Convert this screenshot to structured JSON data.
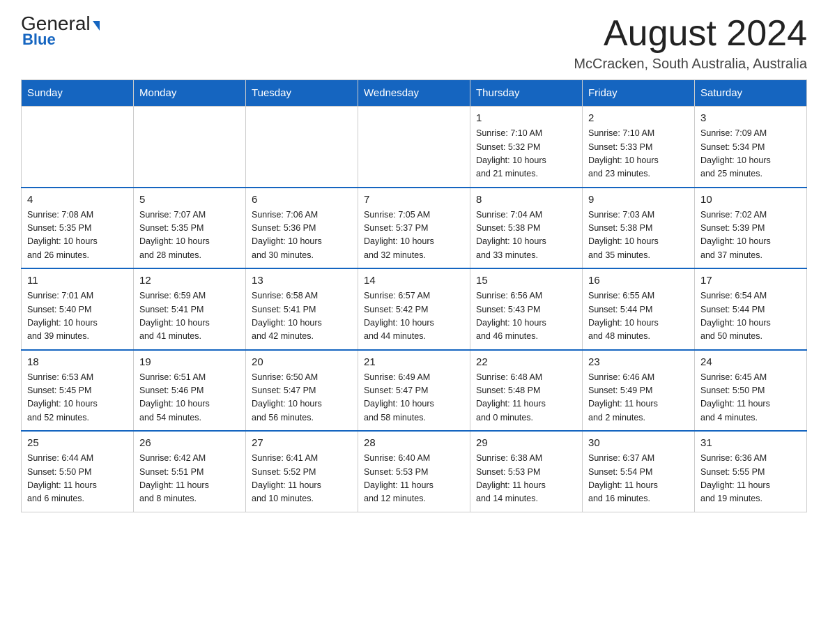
{
  "logo": {
    "part1": "General",
    "arrow": "▶",
    "part2": "Blue"
  },
  "title": "August 2024",
  "location": "McCracken, South Australia, Australia",
  "days_of_week": [
    "Sunday",
    "Monday",
    "Tuesday",
    "Wednesday",
    "Thursday",
    "Friday",
    "Saturday"
  ],
  "weeks": [
    [
      {
        "day": "",
        "info": ""
      },
      {
        "day": "",
        "info": ""
      },
      {
        "day": "",
        "info": ""
      },
      {
        "day": "",
        "info": ""
      },
      {
        "day": "1",
        "info": "Sunrise: 7:10 AM\nSunset: 5:32 PM\nDaylight: 10 hours\nand 21 minutes."
      },
      {
        "day": "2",
        "info": "Sunrise: 7:10 AM\nSunset: 5:33 PM\nDaylight: 10 hours\nand 23 minutes."
      },
      {
        "day": "3",
        "info": "Sunrise: 7:09 AM\nSunset: 5:34 PM\nDaylight: 10 hours\nand 25 minutes."
      }
    ],
    [
      {
        "day": "4",
        "info": "Sunrise: 7:08 AM\nSunset: 5:35 PM\nDaylight: 10 hours\nand 26 minutes."
      },
      {
        "day": "5",
        "info": "Sunrise: 7:07 AM\nSunset: 5:35 PM\nDaylight: 10 hours\nand 28 minutes."
      },
      {
        "day": "6",
        "info": "Sunrise: 7:06 AM\nSunset: 5:36 PM\nDaylight: 10 hours\nand 30 minutes."
      },
      {
        "day": "7",
        "info": "Sunrise: 7:05 AM\nSunset: 5:37 PM\nDaylight: 10 hours\nand 32 minutes."
      },
      {
        "day": "8",
        "info": "Sunrise: 7:04 AM\nSunset: 5:38 PM\nDaylight: 10 hours\nand 33 minutes."
      },
      {
        "day": "9",
        "info": "Sunrise: 7:03 AM\nSunset: 5:38 PM\nDaylight: 10 hours\nand 35 minutes."
      },
      {
        "day": "10",
        "info": "Sunrise: 7:02 AM\nSunset: 5:39 PM\nDaylight: 10 hours\nand 37 minutes."
      }
    ],
    [
      {
        "day": "11",
        "info": "Sunrise: 7:01 AM\nSunset: 5:40 PM\nDaylight: 10 hours\nand 39 minutes."
      },
      {
        "day": "12",
        "info": "Sunrise: 6:59 AM\nSunset: 5:41 PM\nDaylight: 10 hours\nand 41 minutes."
      },
      {
        "day": "13",
        "info": "Sunrise: 6:58 AM\nSunset: 5:41 PM\nDaylight: 10 hours\nand 42 minutes."
      },
      {
        "day": "14",
        "info": "Sunrise: 6:57 AM\nSunset: 5:42 PM\nDaylight: 10 hours\nand 44 minutes."
      },
      {
        "day": "15",
        "info": "Sunrise: 6:56 AM\nSunset: 5:43 PM\nDaylight: 10 hours\nand 46 minutes."
      },
      {
        "day": "16",
        "info": "Sunrise: 6:55 AM\nSunset: 5:44 PM\nDaylight: 10 hours\nand 48 minutes."
      },
      {
        "day": "17",
        "info": "Sunrise: 6:54 AM\nSunset: 5:44 PM\nDaylight: 10 hours\nand 50 minutes."
      }
    ],
    [
      {
        "day": "18",
        "info": "Sunrise: 6:53 AM\nSunset: 5:45 PM\nDaylight: 10 hours\nand 52 minutes."
      },
      {
        "day": "19",
        "info": "Sunrise: 6:51 AM\nSunset: 5:46 PM\nDaylight: 10 hours\nand 54 minutes."
      },
      {
        "day": "20",
        "info": "Sunrise: 6:50 AM\nSunset: 5:47 PM\nDaylight: 10 hours\nand 56 minutes."
      },
      {
        "day": "21",
        "info": "Sunrise: 6:49 AM\nSunset: 5:47 PM\nDaylight: 10 hours\nand 58 minutes."
      },
      {
        "day": "22",
        "info": "Sunrise: 6:48 AM\nSunset: 5:48 PM\nDaylight: 11 hours\nand 0 minutes."
      },
      {
        "day": "23",
        "info": "Sunrise: 6:46 AM\nSunset: 5:49 PM\nDaylight: 11 hours\nand 2 minutes."
      },
      {
        "day": "24",
        "info": "Sunrise: 6:45 AM\nSunset: 5:50 PM\nDaylight: 11 hours\nand 4 minutes."
      }
    ],
    [
      {
        "day": "25",
        "info": "Sunrise: 6:44 AM\nSunset: 5:50 PM\nDaylight: 11 hours\nand 6 minutes."
      },
      {
        "day": "26",
        "info": "Sunrise: 6:42 AM\nSunset: 5:51 PM\nDaylight: 11 hours\nand 8 minutes."
      },
      {
        "day": "27",
        "info": "Sunrise: 6:41 AM\nSunset: 5:52 PM\nDaylight: 11 hours\nand 10 minutes."
      },
      {
        "day": "28",
        "info": "Sunrise: 6:40 AM\nSunset: 5:53 PM\nDaylight: 11 hours\nand 12 minutes."
      },
      {
        "day": "29",
        "info": "Sunrise: 6:38 AM\nSunset: 5:53 PM\nDaylight: 11 hours\nand 14 minutes."
      },
      {
        "day": "30",
        "info": "Sunrise: 6:37 AM\nSunset: 5:54 PM\nDaylight: 11 hours\nand 16 minutes."
      },
      {
        "day": "31",
        "info": "Sunrise: 6:36 AM\nSunset: 5:55 PM\nDaylight: 11 hours\nand 19 minutes."
      }
    ]
  ]
}
